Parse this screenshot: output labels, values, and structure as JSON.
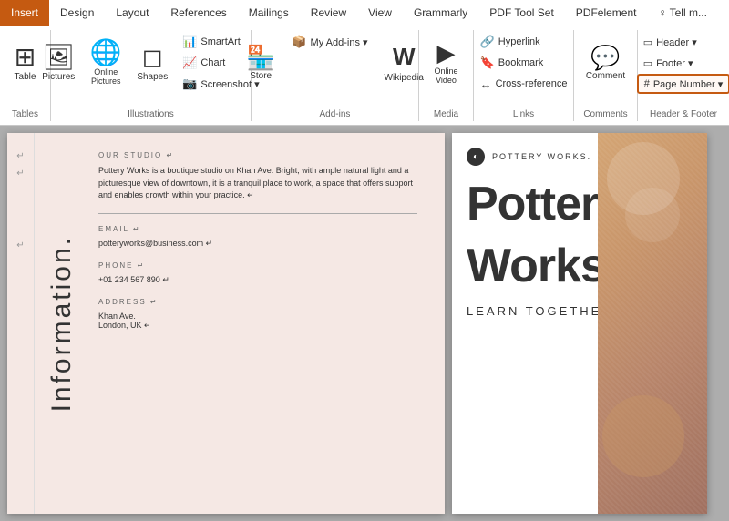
{
  "ribbon": {
    "tabs": [
      {
        "id": "insert",
        "label": "Insert",
        "active": true
      },
      {
        "id": "design",
        "label": "Design",
        "active": false
      },
      {
        "id": "layout",
        "label": "Layout",
        "active": false
      },
      {
        "id": "references",
        "label": "References",
        "active": false
      },
      {
        "id": "mailings",
        "label": "Mailings",
        "active": false
      },
      {
        "id": "review",
        "label": "Review",
        "active": false
      },
      {
        "id": "view",
        "label": "View",
        "active": false
      },
      {
        "id": "grammarly",
        "label": "Grammarly",
        "active": false
      },
      {
        "id": "pdftoolset",
        "label": "PDF Tool Set",
        "active": false
      },
      {
        "id": "pdfelement",
        "label": "PDFelement",
        "active": false
      },
      {
        "id": "tellme",
        "label": "♀ Tell m...",
        "active": false
      }
    ],
    "groups": {
      "tables": {
        "label": "Tables",
        "buttons": [
          {
            "id": "table",
            "label": "Table",
            "icon": "⊞"
          }
        ]
      },
      "illustrations": {
        "label": "Illustrations",
        "buttons": [
          {
            "id": "pictures",
            "label": "Pictures",
            "icon": "🖼"
          },
          {
            "id": "online-pictures",
            "label": "Online\nPictures",
            "icon": "🌐"
          },
          {
            "id": "shapes",
            "label": "Shapes",
            "icon": "△"
          },
          {
            "id": "smartart",
            "label": "SmartArt",
            "icon": "📊"
          },
          {
            "id": "chart",
            "label": "Chart",
            "icon": "📈"
          },
          {
            "id": "screenshot",
            "label": "Screenshot ▾",
            "icon": "📷"
          }
        ]
      },
      "addins": {
        "label": "Add-ins",
        "buttons": [
          {
            "id": "store",
            "label": "Store",
            "icon": "🏪"
          },
          {
            "id": "myaddin",
            "label": "My Add-ins ▾",
            "icon": "📦"
          },
          {
            "id": "wikipedia",
            "label": "Wikipedia",
            "icon": "W"
          }
        ]
      },
      "media": {
        "label": "Media",
        "buttons": [
          {
            "id": "onlinevideo",
            "label": "Online\nVideo",
            "icon": "▶"
          }
        ]
      },
      "links": {
        "label": "Links",
        "buttons": [
          {
            "id": "hyperlink",
            "label": "Hyperlink",
            "icon": "🔗"
          },
          {
            "id": "bookmark",
            "label": "Bookmark",
            "icon": "🔖"
          },
          {
            "id": "crossref",
            "label": "Cross-reference",
            "icon": "↔"
          }
        ]
      },
      "comments": {
        "label": "Comments",
        "buttons": [
          {
            "id": "comment",
            "label": "Comment",
            "icon": "💬"
          }
        ]
      },
      "headerfooter": {
        "label": "Header & Footer",
        "buttons": [
          {
            "id": "header",
            "label": "Header ▾",
            "icon": "—"
          },
          {
            "id": "footer",
            "label": "Footer ▾",
            "icon": "—"
          },
          {
            "id": "pagenumber",
            "label": "Page Number ▾",
            "icon": "#",
            "highlighted": true
          }
        ]
      }
    }
  },
  "document": {
    "left_page": {
      "section_title": "OUR STUDIO ↵",
      "body_text": "Pottery Works is a boutique studio on Khan Ave. Bright, with ample natural light and a picturesque view of downtown, it is a tranquil place to work, a space that offers support and enables growth within your practice.",
      "rotated_label": "Information.",
      "email_label": "EMAIL ↵",
      "email_value": "potteryworks@business.com ↵",
      "phone_label": "PHONE ↵",
      "phone_value": "+01 234 567 890 ↵",
      "address_label": "ADDRESS ↵",
      "address_line1": "Khan Ave.",
      "address_line2": "London, UK ↵"
    },
    "right_page": {
      "brand": "POTTERY WORKS.",
      "title_line1": "Pottery",
      "title_line2": "Worksho",
      "subtitle": "LEARN TOGETHER"
    }
  }
}
